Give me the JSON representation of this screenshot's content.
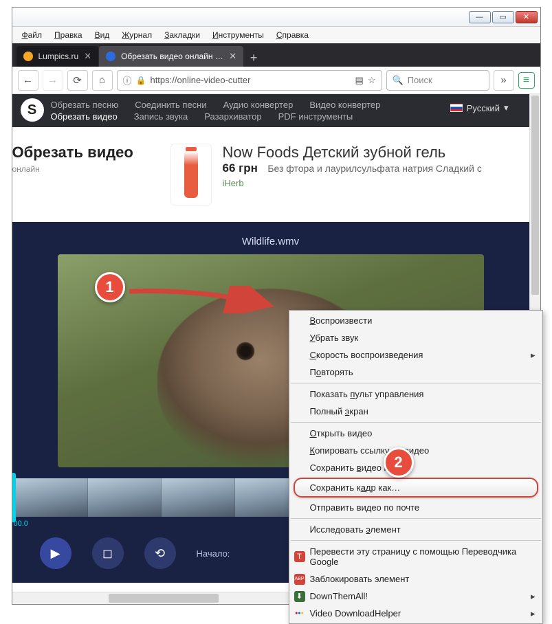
{
  "menubar": [
    "Файл",
    "Правка",
    "Вид",
    "Журнал",
    "Закладки",
    "Инструменты",
    "Справка"
  ],
  "tabs": [
    {
      "label": "Lumpics.ru",
      "active": false,
      "favcolor": "#f5a623"
    },
    {
      "label": "Обрезать видео онлайн - обр",
      "active": true,
      "favcolor": "#2d6cdf"
    }
  ],
  "url": "https://online-video-cutter",
  "search_placeholder": "Поиск",
  "darknav": {
    "row1": [
      "Обрезать песню",
      "Соединить песни",
      "Аудио конвертер",
      "Видео конвертер"
    ],
    "row2": [
      "Обрезать видео",
      "Запись звука",
      "Разархиватор",
      "PDF инструменты"
    ],
    "active": "Обрезать видео",
    "lang": "Русский"
  },
  "page": {
    "title": "Обрезать видео",
    "subtitle": "онлайн"
  },
  "ad": {
    "title": "Now Foods Детский зубной гель",
    "price": "66 грн",
    "desc": "Без фтора и лаурилсульфата натрия Сладкий с",
    "brand": "iHerb"
  },
  "video": {
    "filename": "Wildlife.wmv"
  },
  "timeline": {
    "start_time": "00.0",
    "start_label": "Начало:"
  },
  "markers": {
    "m1": "1",
    "m2": "2"
  },
  "context_menu": {
    "items": [
      {
        "label": "Воспроизвести",
        "u": 0
      },
      {
        "label": "Убрать звук",
        "u": 0
      },
      {
        "label": "Скорость воспроизведения",
        "u": 0,
        "arrow": true
      },
      {
        "label": "Повторять",
        "u": 1
      },
      {
        "sep": true
      },
      {
        "label": "Показать пульт управления",
        "u": 9
      },
      {
        "label": "Полный экран",
        "u": 7
      },
      {
        "sep": true
      },
      {
        "label": "Открыть видео",
        "u": 0
      },
      {
        "label": "Копировать ссылку на видео",
        "u": 0
      },
      {
        "label": "Сохранить видео как",
        "u": 10
      },
      {
        "label": "Сохранить кадр как…",
        "u": 11,
        "highlight": true
      },
      {
        "label": "Отправить видео по почте"
      },
      {
        "sep": true
      },
      {
        "label": "Исследовать элемент",
        "u": 12
      },
      {
        "sep": true
      },
      {
        "label": "Перевести эту страницу с помощью Переводчика Google",
        "icon": "T",
        "iconbg": "#d0443a"
      },
      {
        "label": "Заблокировать элемент",
        "icon": "ABP",
        "iconbg": "#d0443a"
      },
      {
        "label": "DownThemAll!",
        "icon": "⬇",
        "iconbg": "#3a6e3a",
        "arrow": true
      },
      {
        "label": "Video DownloadHelper",
        "icon": "●",
        "iconbg": "transparent",
        "iconcolor": "mix",
        "arrow": true
      }
    ]
  }
}
